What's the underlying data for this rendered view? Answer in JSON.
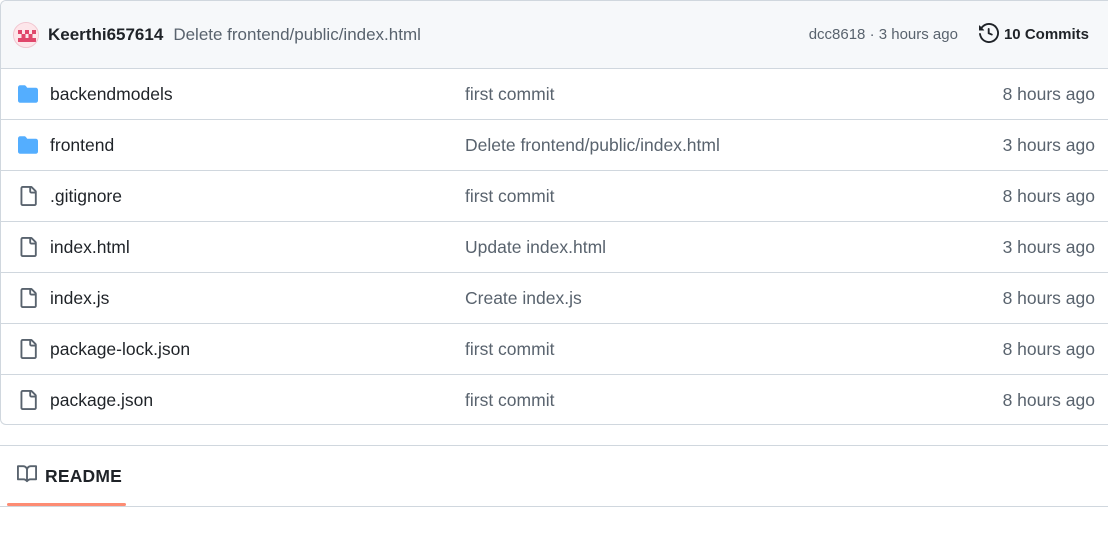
{
  "commit_header": {
    "author": "Keerthi657614",
    "message": "Delete frontend/public/index.html",
    "meta": "dcc8618 · 3 hours ago",
    "commits_label": "10 Commits"
  },
  "files": [
    {
      "type": "folder",
      "name": "backendmodels",
      "message": "first commit",
      "age": "8 hours ago"
    },
    {
      "type": "folder",
      "name": "frontend",
      "message": "Delete frontend/public/index.html",
      "age": "3 hours ago"
    },
    {
      "type": "file",
      "name": ".gitignore",
      "message": "first commit",
      "age": "8 hours ago"
    },
    {
      "type": "file",
      "name": "index.html",
      "message": "Update index.html",
      "age": "3 hours ago"
    },
    {
      "type": "file",
      "name": "index.js",
      "message": "Create index.js",
      "age": "8 hours ago"
    },
    {
      "type": "file",
      "name": "package-lock.json",
      "message": "first commit",
      "age": "8 hours ago"
    },
    {
      "type": "file",
      "name": "package.json",
      "message": "first commit",
      "age": "8 hours ago"
    }
  ],
  "readme": {
    "tab_label": "README",
    "icon": "book-icon"
  },
  "icons": {
    "folder": "folder-icon",
    "file": "file-icon",
    "history": "history-icon"
  },
  "colors": {
    "folder": "#54aeff",
    "accent_underline": "#fd8c73",
    "border": "#d0d7de",
    "header_bg": "#f6f8fa",
    "muted_text": "#59636e"
  }
}
